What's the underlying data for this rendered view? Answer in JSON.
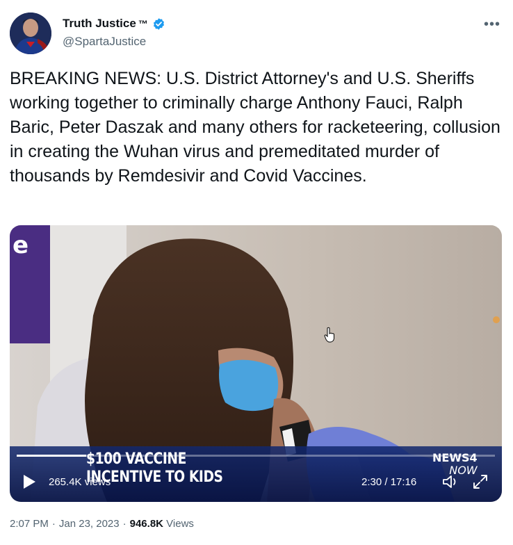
{
  "author": {
    "display_name": "Truth Justice",
    "tm": "™",
    "handle": "@SpartaJustice",
    "verified": true,
    "avatar_icon": "avatar-superhero"
  },
  "more_icon": "more-dots-icon",
  "tweet": {
    "text": "BREAKING NEWS: U.S. District Attorney's and U.S. Sheriffs working together to criminally charge Anthony Fauci, Ralph Baric, Peter Daszak and many others for racketeering, collusion in creating the Wuhan virus and premeditated murder of thousands by Remdesivir and Covid Vaccines."
  },
  "video": {
    "chyron_line1": "$100 VACCINE",
    "chyron_line2": "INCENTIVE TO KIDS",
    "logo_news": "NEWS4",
    "logo_now": "NOW",
    "views": "265.4K views",
    "time": "2:30 / 17:16",
    "progress": 0.145,
    "colors": {
      "chyron": "#0f2a78",
      "accent": "#5b2a86"
    }
  },
  "meta": {
    "time": "2:07 PM",
    "date": "Jan 23, 2023",
    "views_count": "946.8K",
    "views_label": "Views",
    "separator": "·"
  },
  "colors": {
    "verified": "#1d9bf0",
    "secondary": "#536471",
    "primary": "#0f1419"
  }
}
